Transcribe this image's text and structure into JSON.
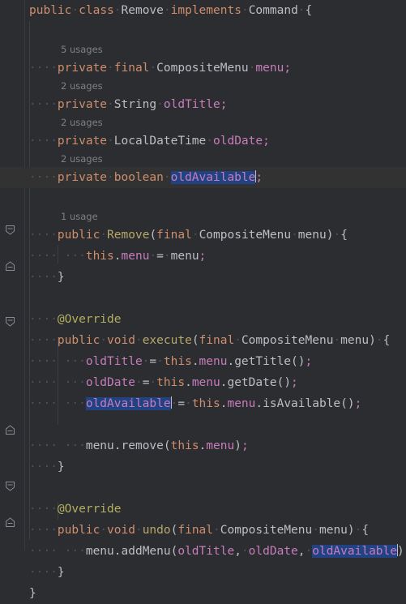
{
  "editor": {
    "language": "java",
    "theme": "IntelliJ Dark",
    "colors": {
      "background": "#2b2d30",
      "caret_line": "#323232",
      "selection": "#214283",
      "keyword": "#cf8e6d",
      "field": "#c77dbb",
      "declaration": "#b7a76b",
      "annotation": "#b3ae60",
      "identifier": "#bcbec4",
      "usage_hint": "#808080",
      "indent_guide": "#3b3f43"
    },
    "selected_text": "oldAvailable"
  },
  "hints": {
    "menu_field": "5 usages",
    "old_title_field": "2 usages",
    "old_date_field": "2 usages",
    "old_available_field": "2 usages",
    "constructor": "1 usage"
  },
  "code": {
    "line01": "public class Remove implements Command {",
    "line03": "private final CompositeMenu menu;",
    "line05": "private String oldTitle;",
    "line07": "private LocalDateTime oldDate;",
    "line09": "private boolean oldAvailable;",
    "line12": "public Remove(final CompositeMenu menu) {",
    "line13": "this.menu = menu;",
    "line14": "}",
    "line16": "@Override",
    "line17": "public void execute(final CompositeMenu menu) {",
    "line18": "oldTitle = this.menu.getTitle();",
    "line19": "oldDate = this.menu.getDate();",
    "line20": "oldAvailable = this.menu.isAvailable();",
    "line22": "menu.remove(this.menu);",
    "line23": "}",
    "line25": "@Override",
    "line26": "public void undo(final CompositeMenu menu) {",
    "line27": "menu.addMenu(oldTitle, oldDate, oldAvailable);",
    "line28": "}",
    "line29": "}"
  },
  "tokens": {
    "kw_public": "public",
    "kw_class": "class",
    "kw_implements": "implements",
    "kw_private": "private",
    "kw_final": "final",
    "kw_boolean": "boolean",
    "kw_void": "void",
    "kw_this": "this",
    "type_Remove": "Remove",
    "type_Command": "Command",
    "type_CompositeMenu": "CompositeMenu",
    "type_String": "String",
    "type_LocalDateTime": "LocalDateTime",
    "fld_menu": "menu",
    "fld_oldTitle": "oldTitle",
    "fld_oldDate": "oldDate",
    "fld_oldAvailable": "oldAvailable",
    "decl_Remove": "Remove",
    "decl_execute": "execute",
    "decl_undo": "undo",
    "ann_override": "@Override",
    "m_getTitle": "getTitle",
    "m_getDate": "getDate",
    "m_isAvailable": "isAvailable",
    "m_remove": "remove",
    "m_addMenu": "addMenu",
    "brace_open": "{",
    "brace_close": "}",
    "paren_open": "(",
    "paren_close": ")",
    "semi": ";",
    "comma": ",",
    "eq": "=",
    "dot": ".",
    "dot_ws": "·"
  },
  "gutter": {
    "fold_expanded_icon": "fold-expanded-icon",
    "fold_end_icon": "fold-end-icon"
  }
}
